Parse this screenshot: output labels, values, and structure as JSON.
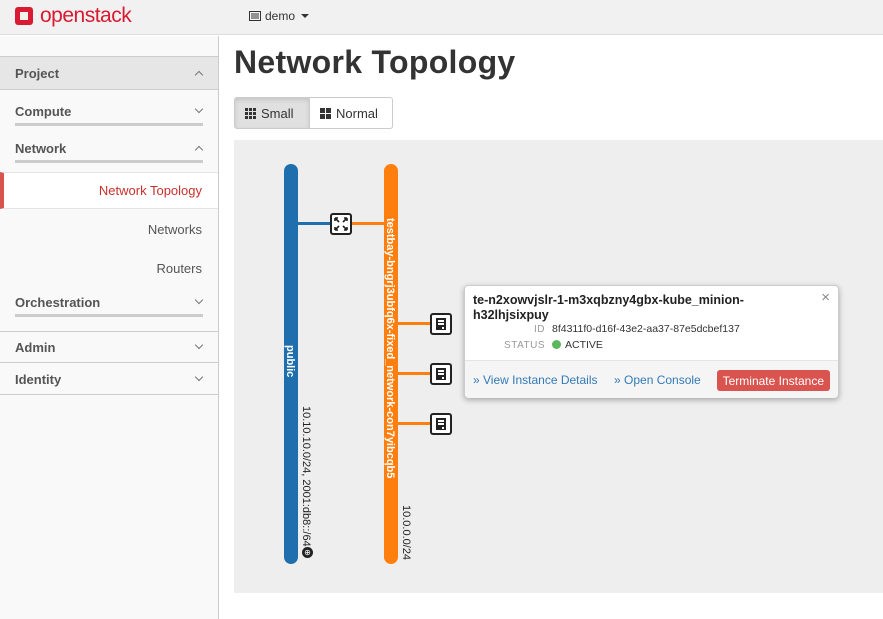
{
  "brand": {
    "name": "openstack",
    "color": "#da1a32"
  },
  "header": {
    "project_menu": "demo"
  },
  "sidebar": {
    "project": "Project",
    "compute": "Compute",
    "network": "Network",
    "items": [
      "Network Topology",
      "Networks",
      "Routers"
    ],
    "orchestration": "Orchestration",
    "admin": "Admin",
    "identity": "Identity"
  },
  "page": {
    "title": "Network Topology"
  },
  "view_buttons": {
    "small": "Small",
    "normal": "Normal"
  },
  "topology": {
    "networks": [
      {
        "name": "public",
        "cidr": "10.10.10.0/24, 2001:db8::/64",
        "color": "#1f6faf"
      },
      {
        "name": "testbay-bngrj3ubfq6x-fixed_network-con7yibcqb5",
        "cidr": "10.0.0.0/24",
        "color": "#ff7f0e"
      }
    ],
    "node_icons": [
      "router-icon",
      "instance-icon",
      "instance-icon",
      "instance-icon"
    ]
  },
  "popup": {
    "title": "te-n2xowvjslr-1-m3xqbzny4gbx-kube_minion-h32lhjsixpuy",
    "id_label": "ID",
    "id_value": "8f4311f0-d16f-43e2-aa37-87e5dcbef137",
    "status_label": "STATUS",
    "status_value": "ACTIVE",
    "status_color": "#5cb85c",
    "close": "×",
    "view_details": "» View Instance Details",
    "open_console": "» Open Console",
    "terminate": "Terminate Instance"
  }
}
